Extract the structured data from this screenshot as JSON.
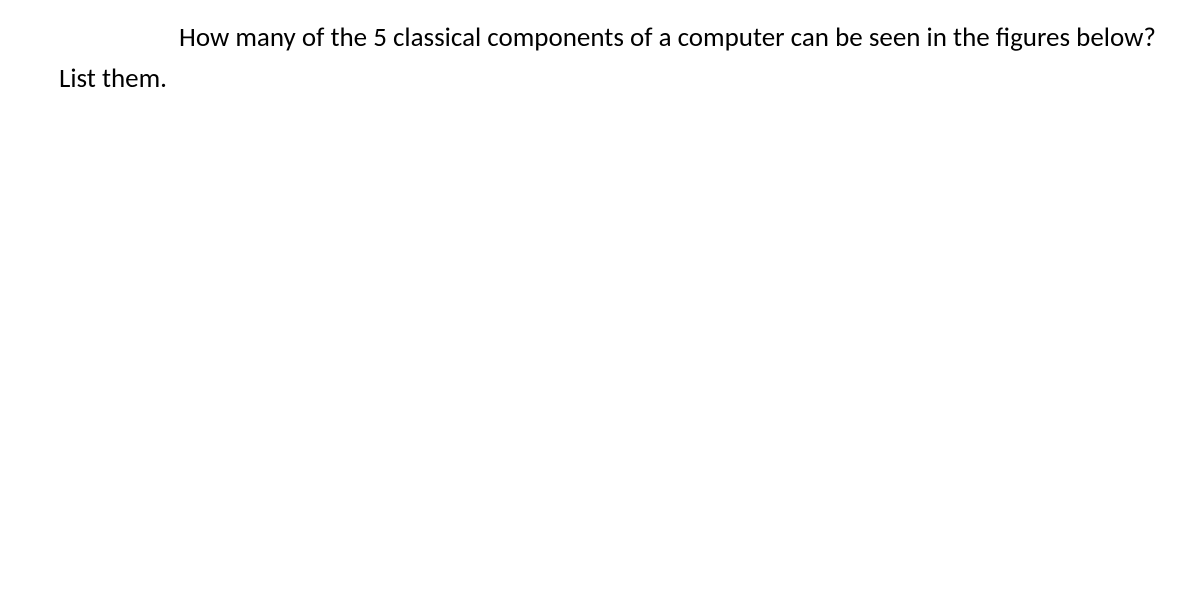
{
  "question": {
    "text": "How many of the 5 classical components of a computer can be seen in the figures below? List them."
  }
}
